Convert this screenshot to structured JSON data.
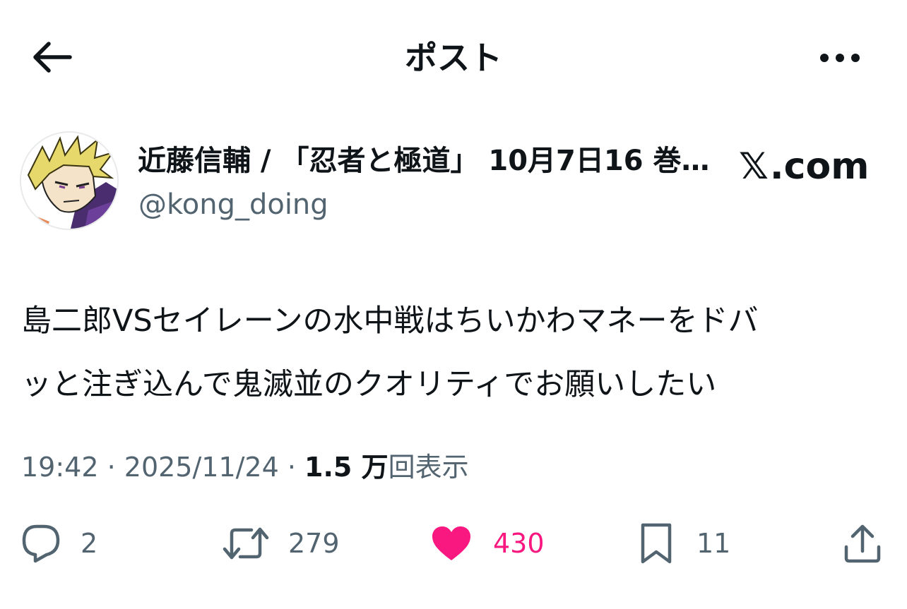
{
  "header": {
    "title": "ポスト"
  },
  "author": {
    "name": "近藤信輔 / 「忍者と極道」 10月7日16 巻…",
    "handle": "@kong_doing",
    "brand": ".com"
  },
  "tweet": {
    "lines": [
      "島二郎VSセイレーンの水中戦はちいかわマネーをドバ",
      "ッと注ぎ込んで鬼滅並のクオリティでお願いしたい"
    ]
  },
  "meta": {
    "time": "19:42",
    "sep1": " · ",
    "date": "2025/11/24",
    "sep2": " · ",
    "views": "1.5 万",
    "views_label": "回表示"
  },
  "actions": {
    "reply_count": "2",
    "repost_count": "279",
    "like_count": "430",
    "bookmark_count": "11"
  },
  "colors": {
    "text": "#0f1419",
    "secondary": "#536471",
    "like": "#f91880"
  },
  "icons": [
    "back-arrow-icon",
    "more-icon",
    "reply-icon",
    "repost-icon",
    "heart-icon",
    "bookmark-icon",
    "share-icon"
  ]
}
